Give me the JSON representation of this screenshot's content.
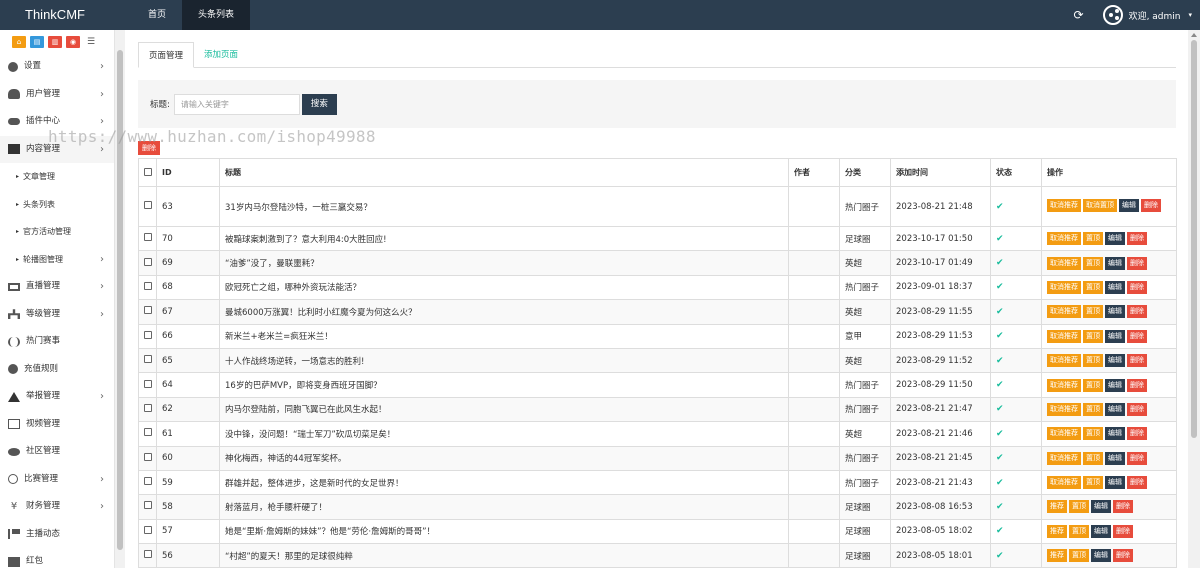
{
  "brand": "ThinkCMF",
  "topnav": [
    {
      "label": "首页",
      "active": false
    },
    {
      "label": "头条列表",
      "active": true
    }
  ],
  "user": {
    "welcome": "欢迎, admin",
    "caret": "▾"
  },
  "sidebar": {
    "items": [
      {
        "label": "设置",
        "icon": "gear-icon",
        "arrow": "›"
      },
      {
        "label": "用户管理",
        "icon": "users-icon",
        "arrow": "›"
      },
      {
        "label": "插件中心",
        "icon": "cloud-icon",
        "arrow": "›"
      },
      {
        "label": "内容管理",
        "icon": "archive-icon",
        "arrow": "›",
        "active": true
      },
      {
        "label": "文章管理",
        "sub": true
      },
      {
        "label": "头条列表",
        "sub": true
      },
      {
        "label": "官方活动管理",
        "sub": true
      },
      {
        "label": "轮播图管理",
        "sub": true,
        "arrow": "›"
      },
      {
        "label": "直播管理",
        "icon": "desktop-icon",
        "arrow": "›"
      },
      {
        "label": "等级管理",
        "icon": "sitemap-icon",
        "arrow": "›"
      },
      {
        "label": "热门赛事",
        "icon": "paren-icon"
      },
      {
        "label": "充值规则",
        "icon": "gear-icon"
      },
      {
        "label": "举报管理",
        "icon": "warning-icon",
        "arrow": "›"
      },
      {
        "label": "视频管理",
        "icon": "file-icon"
      },
      {
        "label": "社区管理",
        "icon": "comment-icon"
      },
      {
        "label": "比赛管理",
        "icon": "circle-icon",
        "arrow": "›"
      },
      {
        "label": "财务管理",
        "icon": "yen-icon",
        "arrow": "›"
      },
      {
        "label": "主播动态",
        "icon": "flag-icon"
      },
      {
        "label": "红包",
        "icon": "gift-icon"
      }
    ]
  },
  "tabs": [
    {
      "label": "页面管理",
      "active": true
    },
    {
      "label": "添加页面",
      "active": false
    }
  ],
  "search": {
    "label": "标题:",
    "placeholder": "请输入关键字",
    "button": "搜索"
  },
  "watermark": "https://www.huzhan.com/ishop49988",
  "delete_all": "删除",
  "table": {
    "headers": {
      "id": "ID",
      "title": "标题",
      "author": "作者",
      "category": "分类",
      "time": "添加时间",
      "status": "状态",
      "ops": "操作"
    },
    "rows": [
      {
        "id": "63",
        "title": "31岁内马尔登陆沙特，一桩三赢交易？",
        "author": "",
        "category": "热门圈子",
        "time": "2023-08-21 21:48",
        "ops": [
          "取消推荐",
          "取消置顶",
          "编辑",
          "删除"
        ]
      },
      {
        "id": "70",
        "title": "被黯球案刺激到了？意大利用4:0大胜回应!",
        "author": "",
        "category": "足球圈",
        "time": "2023-10-17 01:50",
        "ops": [
          "取消推荐",
          "置顶",
          "编辑",
          "删除"
        ]
      },
      {
        "id": "69",
        "title": "“油爹”没了，曼联噩耗？",
        "author": "",
        "category": "英超",
        "time": "2023-10-17 01:49",
        "ops": [
          "取消推荐",
          "置顶",
          "编辑",
          "删除"
        ]
      },
      {
        "id": "68",
        "title": "欧冠死亡之组，哪种外资玩法能活？",
        "author": "",
        "category": "热门圈子",
        "time": "2023-09-01 18:37",
        "ops": [
          "取消推荐",
          "置顶",
          "编辑",
          "删除"
        ]
      },
      {
        "id": "67",
        "title": "曼城6000万涨翼！比利时小红魔今夏为何这么火？",
        "author": "",
        "category": "英超",
        "time": "2023-08-29 11:55",
        "ops": [
          "取消推荐",
          "置顶",
          "编辑",
          "删除"
        ]
      },
      {
        "id": "66",
        "title": "新米兰+老米兰=疯狂米兰！",
        "author": "",
        "category": "意甲",
        "time": "2023-08-29 11:53",
        "ops": [
          "取消推荐",
          "置顶",
          "编辑",
          "删除"
        ]
      },
      {
        "id": "65",
        "title": "十人作战终场逆转，一场意志的胜利!",
        "author": "",
        "category": "英超",
        "time": "2023-08-29 11:52",
        "ops": [
          "取消推荐",
          "置顶",
          "编辑",
          "删除"
        ]
      },
      {
        "id": "64",
        "title": "16岁的巴萨MVP，即将变身西班牙国脚？",
        "author": "",
        "category": "热门圈子",
        "time": "2023-08-29 11:50",
        "ops": [
          "取消推荐",
          "置顶",
          "编辑",
          "删除"
        ]
      },
      {
        "id": "62",
        "title": "内马尔登陆前，同胞飞翼已在此风生水起！",
        "author": "",
        "category": "热门圈子",
        "time": "2023-08-21 21:47",
        "ops": [
          "取消推荐",
          "置顶",
          "编辑",
          "删除"
        ]
      },
      {
        "id": "61",
        "title": "没中锋，没问题！“瑞士军刀”砍瓜切菜足矣！",
        "author": "",
        "category": "英超",
        "time": "2023-08-21 21:46",
        "ops": [
          "取消推荐",
          "置顶",
          "编辑",
          "删除"
        ]
      },
      {
        "id": "60",
        "title": "神化梅西，神话的44冠军奖杯。",
        "author": "",
        "category": "热门圈子",
        "time": "2023-08-21 21:45",
        "ops": [
          "取消推荐",
          "置顶",
          "编辑",
          "删除"
        ]
      },
      {
        "id": "59",
        "title": "群雄并起，整体进步，这是新时代的女足世界！",
        "author": "",
        "category": "热门圈子",
        "time": "2023-08-21 21:43",
        "ops": [
          "取消推荐",
          "置顶",
          "编辑",
          "删除"
        ]
      },
      {
        "id": "58",
        "title": "射落蓝月，枪手腰杆硬了！",
        "author": "",
        "category": "足球圈",
        "time": "2023-08-08 16:53",
        "ops": [
          "推荐",
          "置顶",
          "编辑",
          "删除"
        ]
      },
      {
        "id": "57",
        "title": "她是“里斯·詹姆斯的妹妹”？他是“劳伦·詹姆斯的哥哥”！",
        "author": "",
        "category": "足球圈",
        "time": "2023-08-05 18:02",
        "ops": [
          "推荐",
          "置顶",
          "编辑",
          "删除"
        ]
      },
      {
        "id": "56",
        "title": "“村超”的夏天！那里的足球很纯粹",
        "author": "",
        "category": "足球圈",
        "time": "2023-08-05 18:01",
        "ops": [
          "推荐",
          "置顶",
          "编辑",
          "删除"
        ]
      }
    ]
  },
  "colors": {
    "topbar": "#2c3e50",
    "accent": "#18bc9c",
    "warning": "#f39c12",
    "danger": "#e74c3c"
  }
}
